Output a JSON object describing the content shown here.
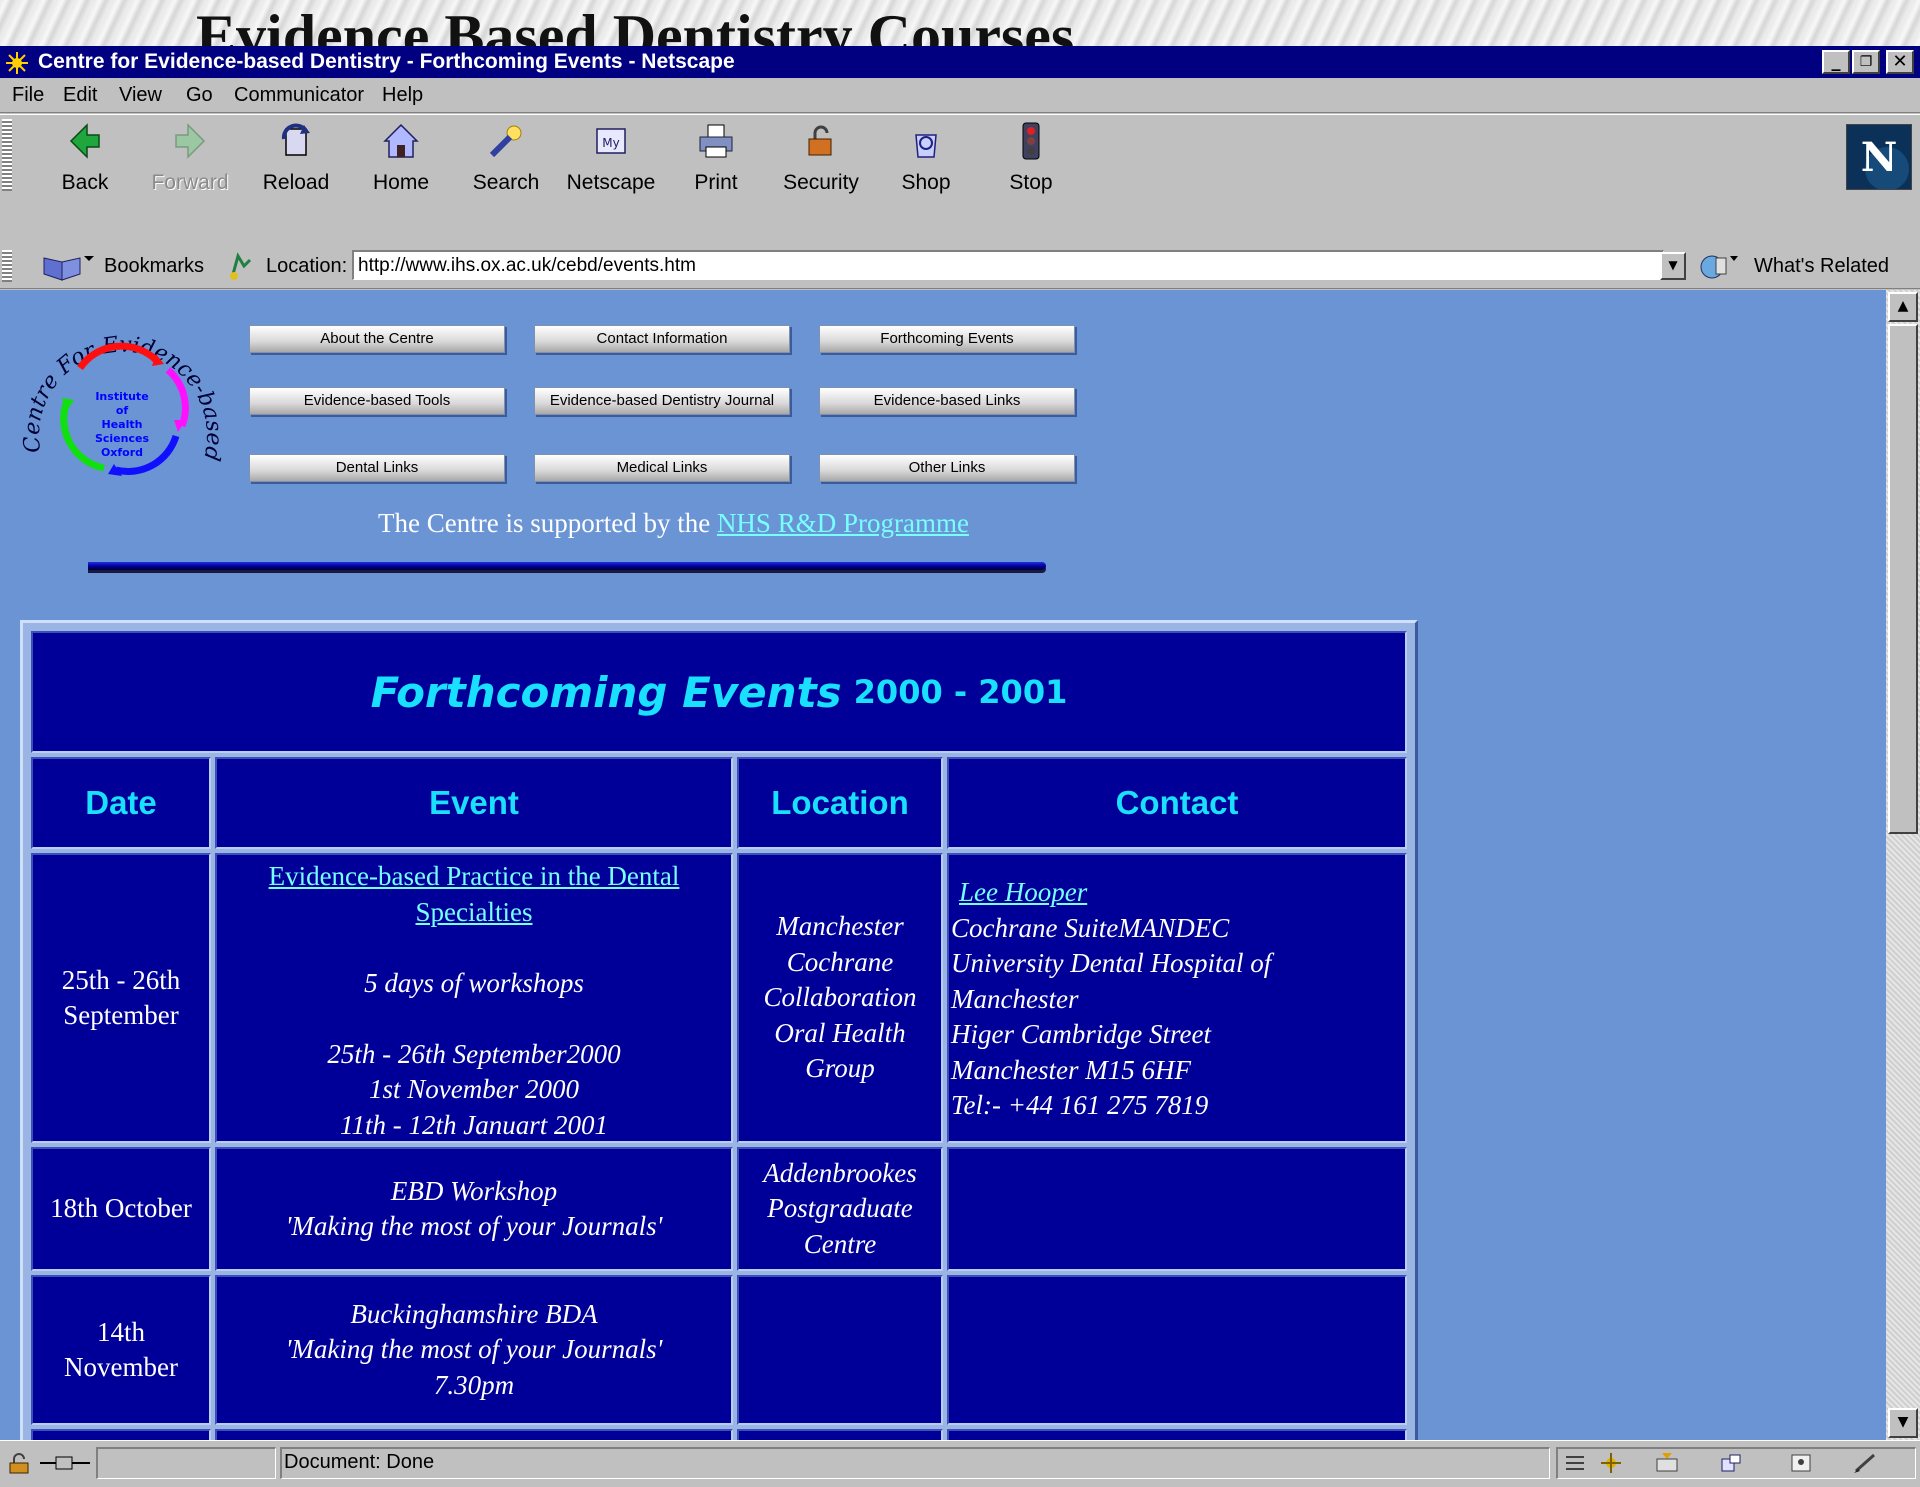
{
  "slide": {
    "title": "Evidence Based Dentistry Courses"
  },
  "window": {
    "title": "Centre for Evidence-based Dentistry - Forthcoming Events - Netscape"
  },
  "menu": [
    "File",
    "Edit",
    "View",
    "Go",
    "Communicator",
    "Help"
  ],
  "toolbar": {
    "back": "Back",
    "forward": "Forward",
    "reload": "Reload",
    "home": "Home",
    "search": "Search",
    "netscape": "Netscape",
    "print": "Print",
    "security": "Security",
    "shop": "Shop",
    "stop": "Stop"
  },
  "location": {
    "bookmarks": "Bookmarks",
    "label": "Location:",
    "url": "http://www.ihs.ox.ac.uk/cebd/events.htm",
    "whats_related": "What's Related"
  },
  "logo": {
    "ring_text": "Centre For Evidence-based Dentistry",
    "inner": [
      "Institute",
      "of",
      "Health",
      "Sciences",
      "Oxford"
    ]
  },
  "nav": [
    "About the Centre",
    "Contact Information",
    "Forthcoming Events",
    "Evidence-based Tools",
    "Evidence-based Dentistry Journal",
    "Evidence-based Links",
    "Dental Links",
    "Medical Links",
    "Other Links"
  ],
  "support": {
    "text": "The Centre is supported by the ",
    "link": "NHS R&D Programme"
  },
  "events": {
    "title": "Forthcoming Events",
    "years": "2000 - 2001",
    "headers": {
      "date": "Date",
      "event": "Event",
      "location": "Location",
      "contact": "Contact"
    },
    "rows": [
      {
        "date": [
          "25th - 26th",
          "September"
        ],
        "event_link": [
          "Evidence-based Practice in the Dental",
          "Specialties"
        ],
        "event_lines": [
          "",
          "5 days of workshops",
          "",
          "25th - 26th September2000",
          "1st November 2000",
          "11th - 12th Januart 2001"
        ],
        "location": [
          "Manchester",
          "Cochrane",
          "Collaboration",
          "Oral Health",
          "Group"
        ],
        "contact_link": "Lee Hooper",
        "contact_lines": [
          "Cochrane SuiteMANDEC",
          "University Dental Hospital of",
          "Manchester",
          "Higer Cambridge Street",
          "Manchester M15 6HF",
          "Tel:- +44 161 275 7819"
        ]
      },
      {
        "date": [
          "18th October"
        ],
        "event_lines": [
          "EBD Workshop",
          "'Making the most of your Journals'"
        ],
        "location": [
          "Addenbrookes",
          "Postgraduate",
          "Centre"
        ]
      },
      {
        "date": [
          "14th",
          "November"
        ],
        "event_lines": [
          "Buckinghamshire BDA",
          "'Making the most of your Journals'",
          "7.30pm"
        ]
      }
    ]
  },
  "status": {
    "text": "Document: Done"
  }
}
